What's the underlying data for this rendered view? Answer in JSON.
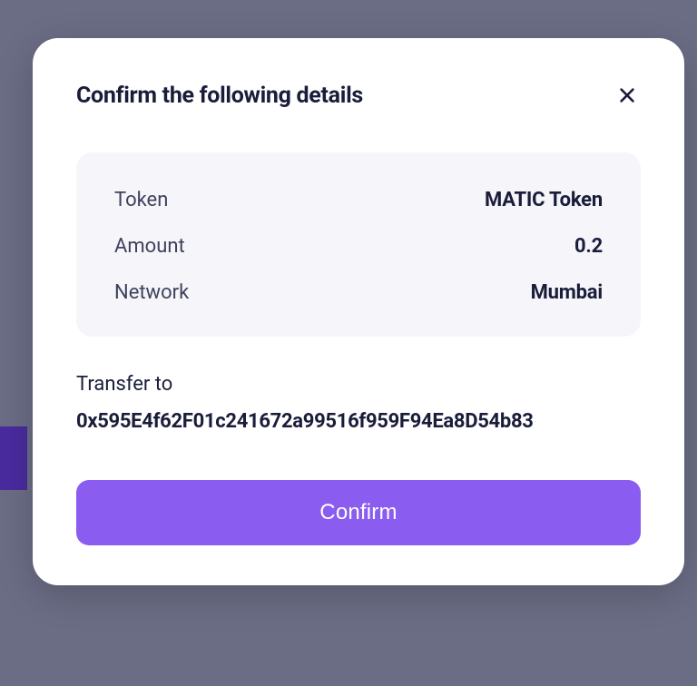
{
  "modal": {
    "title": "Confirm the following details",
    "details": {
      "token_label": "Token",
      "token_value": "MATIC Token",
      "amount_label": "Amount",
      "amount_value": "0.2",
      "network_label": "Network",
      "network_value": "Mumbai"
    },
    "transfer": {
      "label": "Transfer to",
      "address": "0x595E4f62F01c241672a99516f959F94Ea8D54b83"
    },
    "confirm_label": "Confirm"
  }
}
